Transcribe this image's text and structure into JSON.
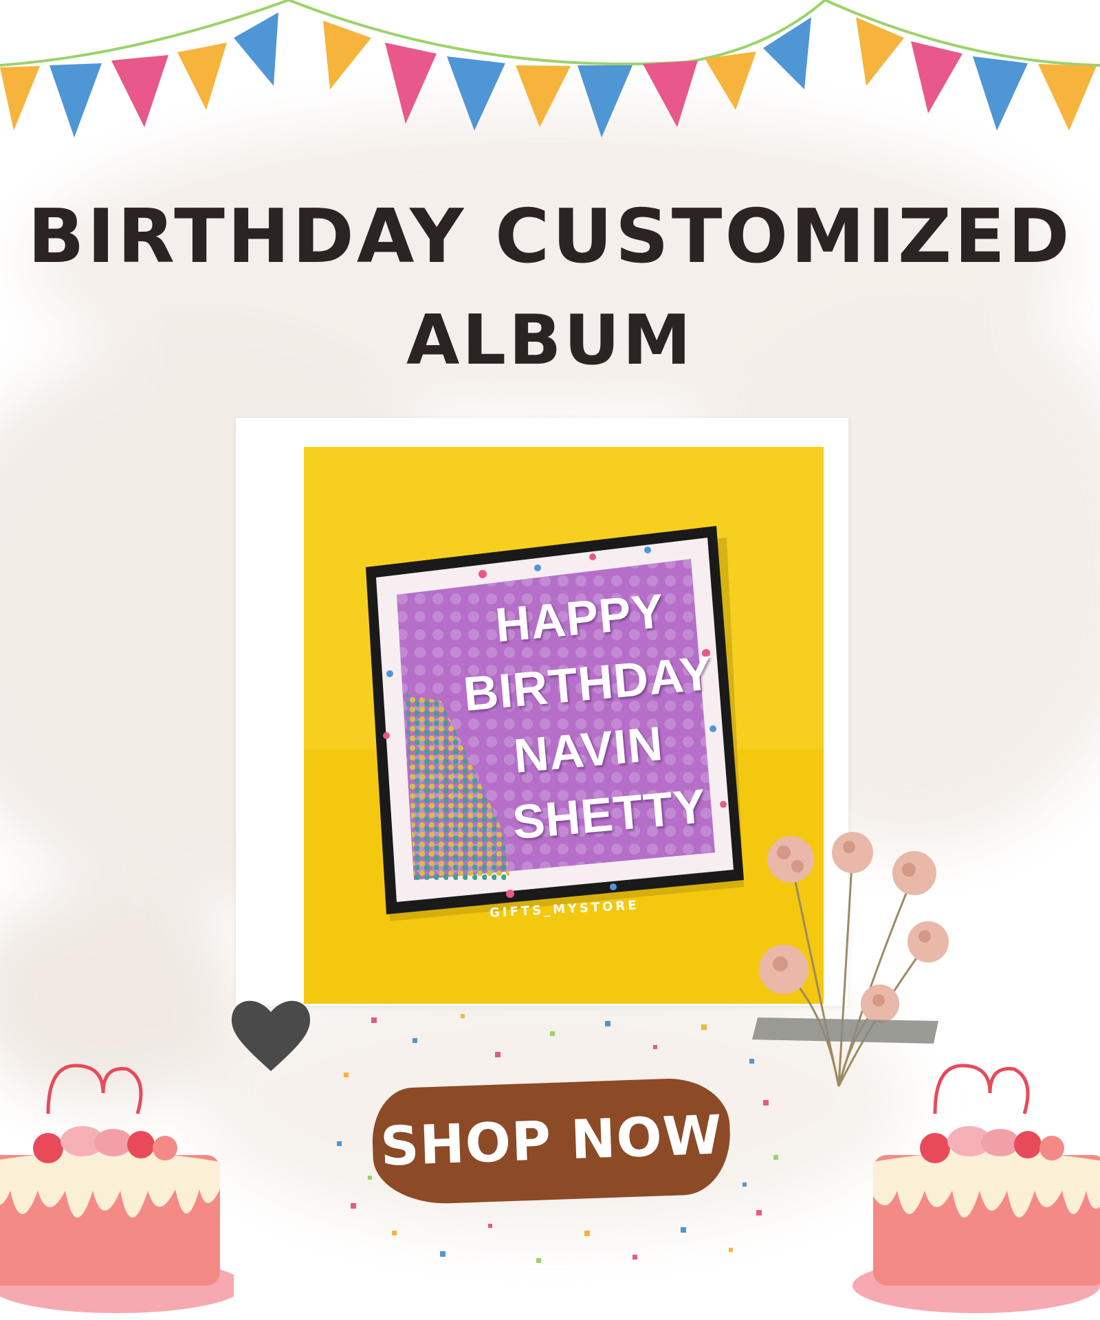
{
  "title": {
    "line1": "BIRTHDAY CUSTOMIZED",
    "line2": "ALBUM"
  },
  "product_photo": {
    "message_lines": [
      "HAPPY",
      "BIRTHDAY",
      "NAVIN",
      "SHETTY"
    ],
    "watermark": "GIFTS_MYSTORE"
  },
  "cta": {
    "label": "SHOP NOW"
  },
  "colors": {
    "title": "#2b2422",
    "button": "#8c4a26",
    "photo_background": "#f7cf1e",
    "album_inner": "#b66fc9",
    "heart": "#4a4a4a",
    "cake": "#f48a86"
  },
  "decorations": [
    "bunting-banner",
    "heart-icon",
    "dried-flowers",
    "confetti",
    "cake-left",
    "cake-right"
  ]
}
